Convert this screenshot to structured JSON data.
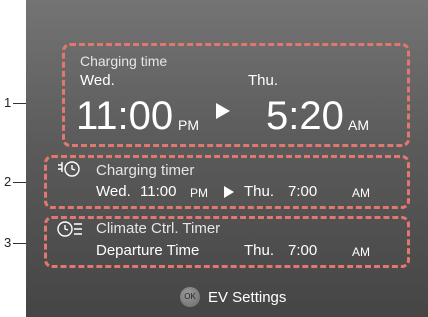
{
  "callouts": [
    "1",
    "2",
    "3"
  ],
  "charging_time": {
    "title": "Charging time",
    "start_day": "Wed.",
    "end_day": "Thu.",
    "start_time": "11:00",
    "start_ampm": "PM",
    "end_time": "5:20",
    "end_ampm": "AM"
  },
  "charging_timer": {
    "title": "Charging timer",
    "start_day": "Wed.",
    "start_time": "11:00",
    "start_ampm": "PM",
    "end_day": "Thu.",
    "end_time": "7:00",
    "end_ampm": "AM"
  },
  "climate_timer": {
    "title": "Climate Ctrl. Timer",
    "label": "Departure Time",
    "day": "Thu.",
    "time": "7:00",
    "ampm": "AM"
  },
  "footer": {
    "ok_label": "OK",
    "settings_label": "EV Settings"
  },
  "colors": {
    "highlight_border": "#e2776e",
    "text": "#ffffff"
  },
  "icons": {
    "arrow": "play-arrow-icon",
    "charging_timer": "plug-clock-icon",
    "climate_timer": "clock-fan-icon"
  }
}
